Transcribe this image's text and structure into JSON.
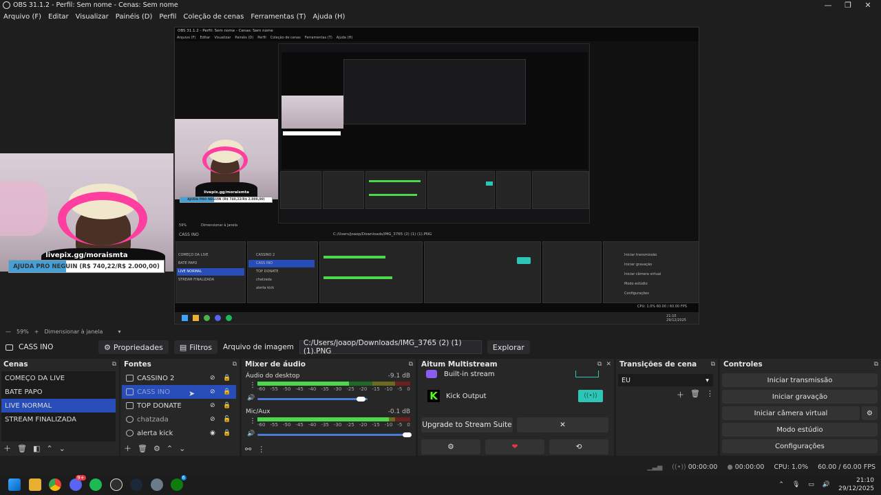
{
  "window": {
    "title": "OBS 31.1.2 - Perfil: Sem nome - Cenas: Sem nome",
    "minimize": "—",
    "maximize": "❐",
    "close": "✕"
  },
  "menu": [
    "Arquivo (F)",
    "Editar",
    "Visualizar",
    "Painéis (D)",
    "Perfil",
    "Coleção de cenas",
    "Ferramentas (T)",
    "Ajuda (H)"
  ],
  "preview": {
    "overlay_handle": "livepix.gg/moraismta",
    "donate_label": "AJUDA PRO NEGUIN (R$ 740,22/R$ 2.000,00)",
    "donate_progress": 0.37,
    "nested_title": "OBS 31.1.2 - Perfil: Sem nome - Cenas: Sem nome",
    "nested_menu": [
      "Arquivo (F)",
      "Editar",
      "Visualizar",
      "Painéis (D)",
      "Perfil",
      "Coleção de cenas",
      "Ferramentas (T)",
      "Ajuda (H)"
    ],
    "nested_source": "CASS INO",
    "nested_path": "C:/Users/joaop/Downloads/IMG_3765 (2) (1) (1).PNG",
    "nested_scenes": [
      "COMEÇO DA LIVE",
      "BATE PAPO",
      "LIVE NORMAL",
      "STREAM FINALIZADA"
    ],
    "nested_sources": [
      "CASSINO 2",
      "CASS INO",
      "TOP DONATE",
      "chatzada",
      "alerta kick"
    ],
    "nested_controls": [
      "Iniciar transmissão",
      "Iniciar gravação",
      "Iniciar câmera virtual",
      "Modo estúdio",
      "Configurações"
    ],
    "nested_status": "CPU: 1.0%    60.00 / 60.00 FPS",
    "nested_clock": "21:10\n29/12/2025",
    "nested_zoom": "59%",
    "nested_zoom_label": "Dimensionar à janela"
  },
  "zoom": {
    "value": "59%",
    "label": "Dimensionar à janela"
  },
  "source_toolbar": {
    "source_name": "CASS INO",
    "properties": "Propriedades",
    "filters": "Filtros",
    "image_file_label": "Arquivo de imagem",
    "path": "C:/Users/joaop/Downloads/IMG_3765 (2) (1) (1).PNG",
    "browse": "Explorar"
  },
  "scenes": {
    "title": "Cenas",
    "items": [
      "COMEÇO DA LIVE",
      "BATE PAPO",
      "LIVE NORMAL",
      "STREAM FINALIZADA"
    ],
    "selected_index": 2
  },
  "sources": {
    "title": "Fontes",
    "items": [
      {
        "label": "CASSINO 2",
        "icon": "image-icon",
        "visible": false,
        "locked": true
      },
      {
        "label": "CASS INO",
        "icon": "image-icon",
        "visible": false,
        "locked": true
      },
      {
        "label": "TOP DONATE",
        "icon": "image-icon",
        "visible": false,
        "locked": true
      },
      {
        "label": "chatzada",
        "icon": "browser-icon",
        "visible": false,
        "locked": false
      },
      {
        "label": "alerta kick",
        "icon": "browser-icon",
        "visible": true,
        "locked": true
      }
    ],
    "selected_index": 1
  },
  "mixer": {
    "title": "Mixer de áudio",
    "channels": [
      {
        "name": "Áudio do desktop",
        "db": "-9.1 dB",
        "level": 0.6,
        "volume": 0.84
      },
      {
        "name": "Mic/Aux",
        "db": "-0.1 dB",
        "level": 0.86,
        "volume": 0.98
      }
    ],
    "scale": [
      "-60",
      "-55",
      "-50",
      "-45",
      "-40",
      "-35",
      "-30",
      "-25",
      "-20",
      "-15",
      "-10",
      "-5",
      "0"
    ]
  },
  "aitum": {
    "title": "Aitum Multistream",
    "builtin_label": "Built-in stream",
    "kick_label": "Kick Output",
    "upgrade": "Upgrade to Stream Suite",
    "close_x": "✕"
  },
  "transitions": {
    "title": "Transições de cena",
    "selected": "EU"
  },
  "controls": {
    "title": "Controles",
    "buttons": [
      "Iniciar transmissão",
      "Iniciar gravação",
      "Iniciar câmera virtual",
      "Modo estúdio",
      "Configurações"
    ]
  },
  "status": {
    "stream_time": "00:00:00",
    "record_time": "00:00:00",
    "cpu": "CPU: 1.0%",
    "fps": "60.00 / 60.00 FPS"
  },
  "taskbar": {
    "icons": [
      "windows-icon",
      "explorer-icon",
      "chrome-icon",
      "discord-icon",
      "spotify-icon",
      "obs-icon",
      "steam-icon",
      "settings-icon",
      "xbox-icon"
    ],
    "time": "21:10",
    "date": "29/12/2025",
    "discord_badge": "9+",
    "xbox_badge": "6"
  },
  "colors": {
    "accent": "#284cb8",
    "kick_green": "#53fc18",
    "toggle_teal": "#2ec4b6",
    "heart_red": "#e53945"
  }
}
